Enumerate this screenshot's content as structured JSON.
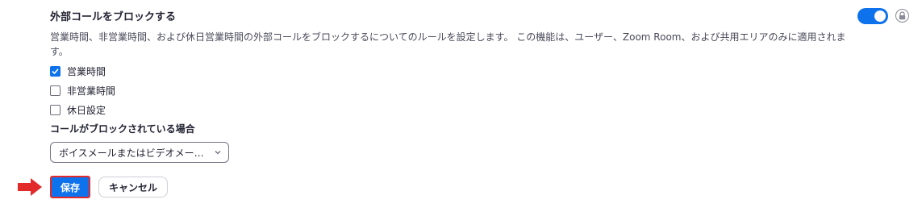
{
  "setting": {
    "title": "外部コールをブロックする",
    "description": "営業時間、非営業時間、および休日営業時間の外部コールをブロックするについてのルールを設定します。 この機能は、ユーザー、Zoom Room、および共用エリアのみに適用されます。",
    "toggle_enabled": true
  },
  "options": [
    {
      "label": "営業時間",
      "checked": true
    },
    {
      "label": "非営業時間",
      "checked": false
    },
    {
      "label": "休日設定",
      "checked": false
    }
  ],
  "blocked": {
    "heading": "コールがブロックされている場合",
    "selected_value": "ボイスメールまたはビデオメー…"
  },
  "actions": {
    "save_label": "保存",
    "cancel_label": "キャンセル"
  },
  "colors": {
    "accent": "#0e72ed",
    "highlight": "#e32a2a"
  },
  "icons": {
    "toggle": "toggle-switch-icon",
    "lock": "lock-icon",
    "chevron": "chevron-down-icon",
    "arrow": "red-arrow-icon"
  }
}
